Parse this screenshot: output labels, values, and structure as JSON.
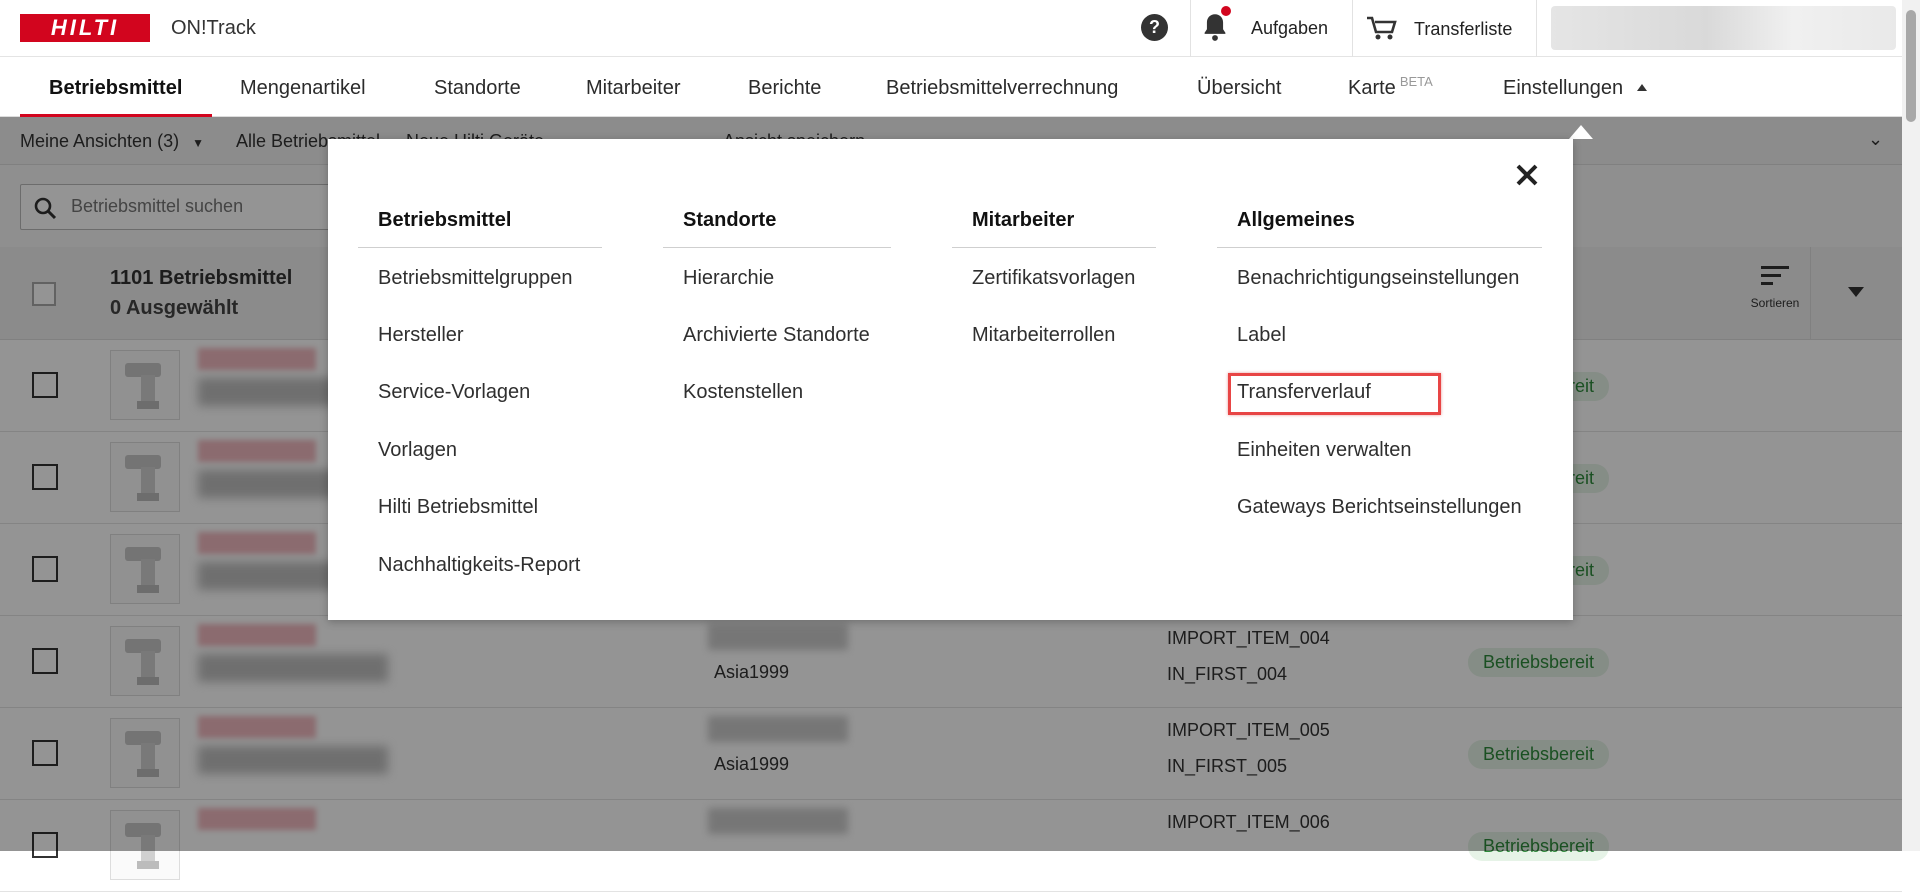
{
  "header": {
    "logo_text": "HILTI",
    "app_name": "ON!Track",
    "help_icon": "?",
    "tasks_label": "Aufgaben",
    "transfer_label": "Transferliste",
    "brand_color": "#d2051e"
  },
  "nav": {
    "items": [
      {
        "label": "Betriebsmittel",
        "active": true
      },
      {
        "label": "Mengenartikel"
      },
      {
        "label": "Standorte"
      },
      {
        "label": "Mitarbeiter"
      },
      {
        "label": "Berichte"
      },
      {
        "label": "Betriebsmittelverrechnung"
      },
      {
        "label": "Übersicht"
      },
      {
        "label": "Karte",
        "badge": "BETA"
      },
      {
        "label": "Einstellungen",
        "expanded": true
      }
    ]
  },
  "views_bar": {
    "my_views": "Meine Ansichten",
    "my_views_count": "(3)",
    "all_label": "Alle Betriebsmittel",
    "new_label": "Neue Hilti Geräte",
    "save_view": "Ansicht speichern"
  },
  "search": {
    "placeholder": "Betriebsmittel suchen"
  },
  "list": {
    "count_title": "1101 Betriebsmittel",
    "selected": "0 Ausgewählt",
    "sort_label": "Sortieren",
    "rows": [
      {
        "owner": "",
        "code1": "",
        "code2": "",
        "status": "Betriebsbereit"
      },
      {
        "owner": "",
        "code1": "",
        "code2": "",
        "status": "Betriebsbereit"
      },
      {
        "owner": "",
        "code1": "",
        "code2": "",
        "status": "Betriebsbereit"
      },
      {
        "owner": "Asia1999",
        "code1": "IMPORT_ITEM_004",
        "code2": "IN_FIRST_004",
        "status": "Betriebsbereit"
      },
      {
        "owner": "Asia1999",
        "code1": "IMPORT_ITEM_005",
        "code2": "IN_FIRST_005",
        "status": "Betriebsbereit"
      },
      {
        "owner": "",
        "code1": "IMPORT_ITEM_006",
        "code2": "",
        "status": "Betriebsbereit"
      }
    ]
  },
  "settings_menu": {
    "columns": [
      {
        "title": "Betriebsmittel",
        "links": [
          "Betriebsmittelgruppen",
          "Hersteller",
          "Service-Vorlagen",
          "Vorlagen",
          "Hilti Betriebsmittel",
          "Nachhaltigkeits-Report"
        ]
      },
      {
        "title": "Standorte",
        "links": [
          "Hierarchie",
          "Archivierte Standorte",
          "Kostenstellen"
        ]
      },
      {
        "title": "Mitarbeiter",
        "links": [
          "Zertifikatsvorlagen",
          "Mitarbeiterrollen"
        ]
      },
      {
        "title": "Allgemeines",
        "links": [
          "Benachrichtigungseinstellungen",
          "Label",
          "Transferverlauf",
          "Einheiten verwalten",
          "Gateways Berichtseinstellungen"
        ]
      }
    ],
    "highlighted_link": "Transferverlauf"
  }
}
